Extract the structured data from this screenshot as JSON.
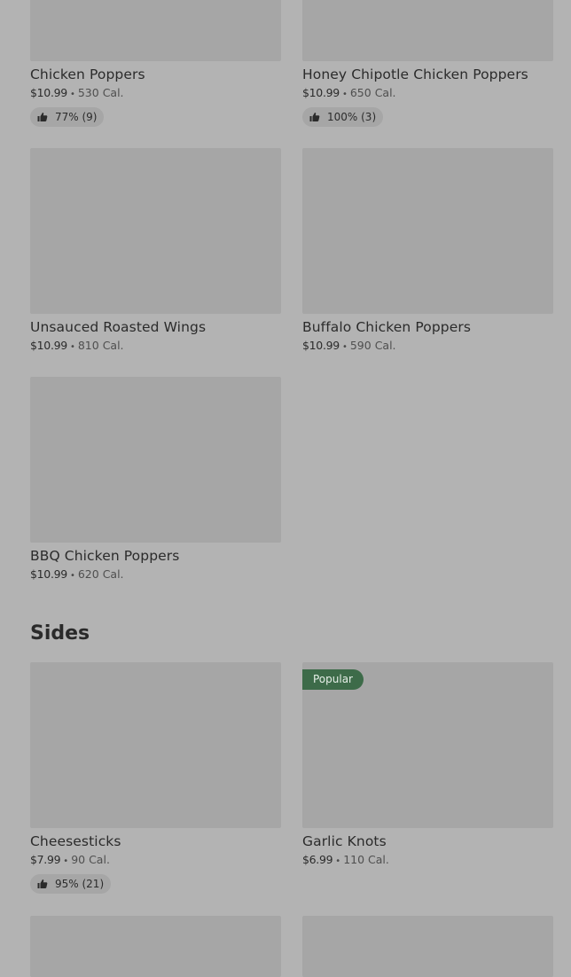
{
  "entrees": [
    {
      "name": "Chicken Poppers",
      "price": "$10.99",
      "separator": "•",
      "calories": "530 Cal.",
      "rating": "77% (9)"
    },
    {
      "name": "Honey Chipotle Chicken Poppers",
      "price": "$10.99",
      "separator": "•",
      "calories": "650 Cal.",
      "rating": "100% (3)"
    },
    {
      "name": "Unsauced Roasted Wings",
      "price": "$10.99",
      "separator": "•",
      "calories": "810 Cal."
    },
    {
      "name": "Buffalo Chicken Poppers",
      "price": "$10.99",
      "separator": "•",
      "calories": "590 Cal."
    },
    {
      "name": "BBQ Chicken Poppers",
      "price": "$10.99",
      "separator": "•",
      "calories": "620 Cal."
    }
  ],
  "sides_section": {
    "title": "Sides",
    "items": [
      {
        "name": "Cheesesticks",
        "price": "$7.99",
        "separator": "•",
        "calories": "90 Cal.",
        "rating": "95% (21)"
      },
      {
        "name": "Garlic Knots",
        "price": "$6.99",
        "separator": "•",
        "calories": "110 Cal.",
        "badge": "Popular"
      }
    ]
  },
  "icons": {
    "rating": "thumbs-up-icon"
  },
  "colors": {
    "background": "#b3b3b3",
    "image_placeholder": "#a6a6a6",
    "popular_badge": "#3d6b49",
    "text": "#2b2b2b"
  }
}
